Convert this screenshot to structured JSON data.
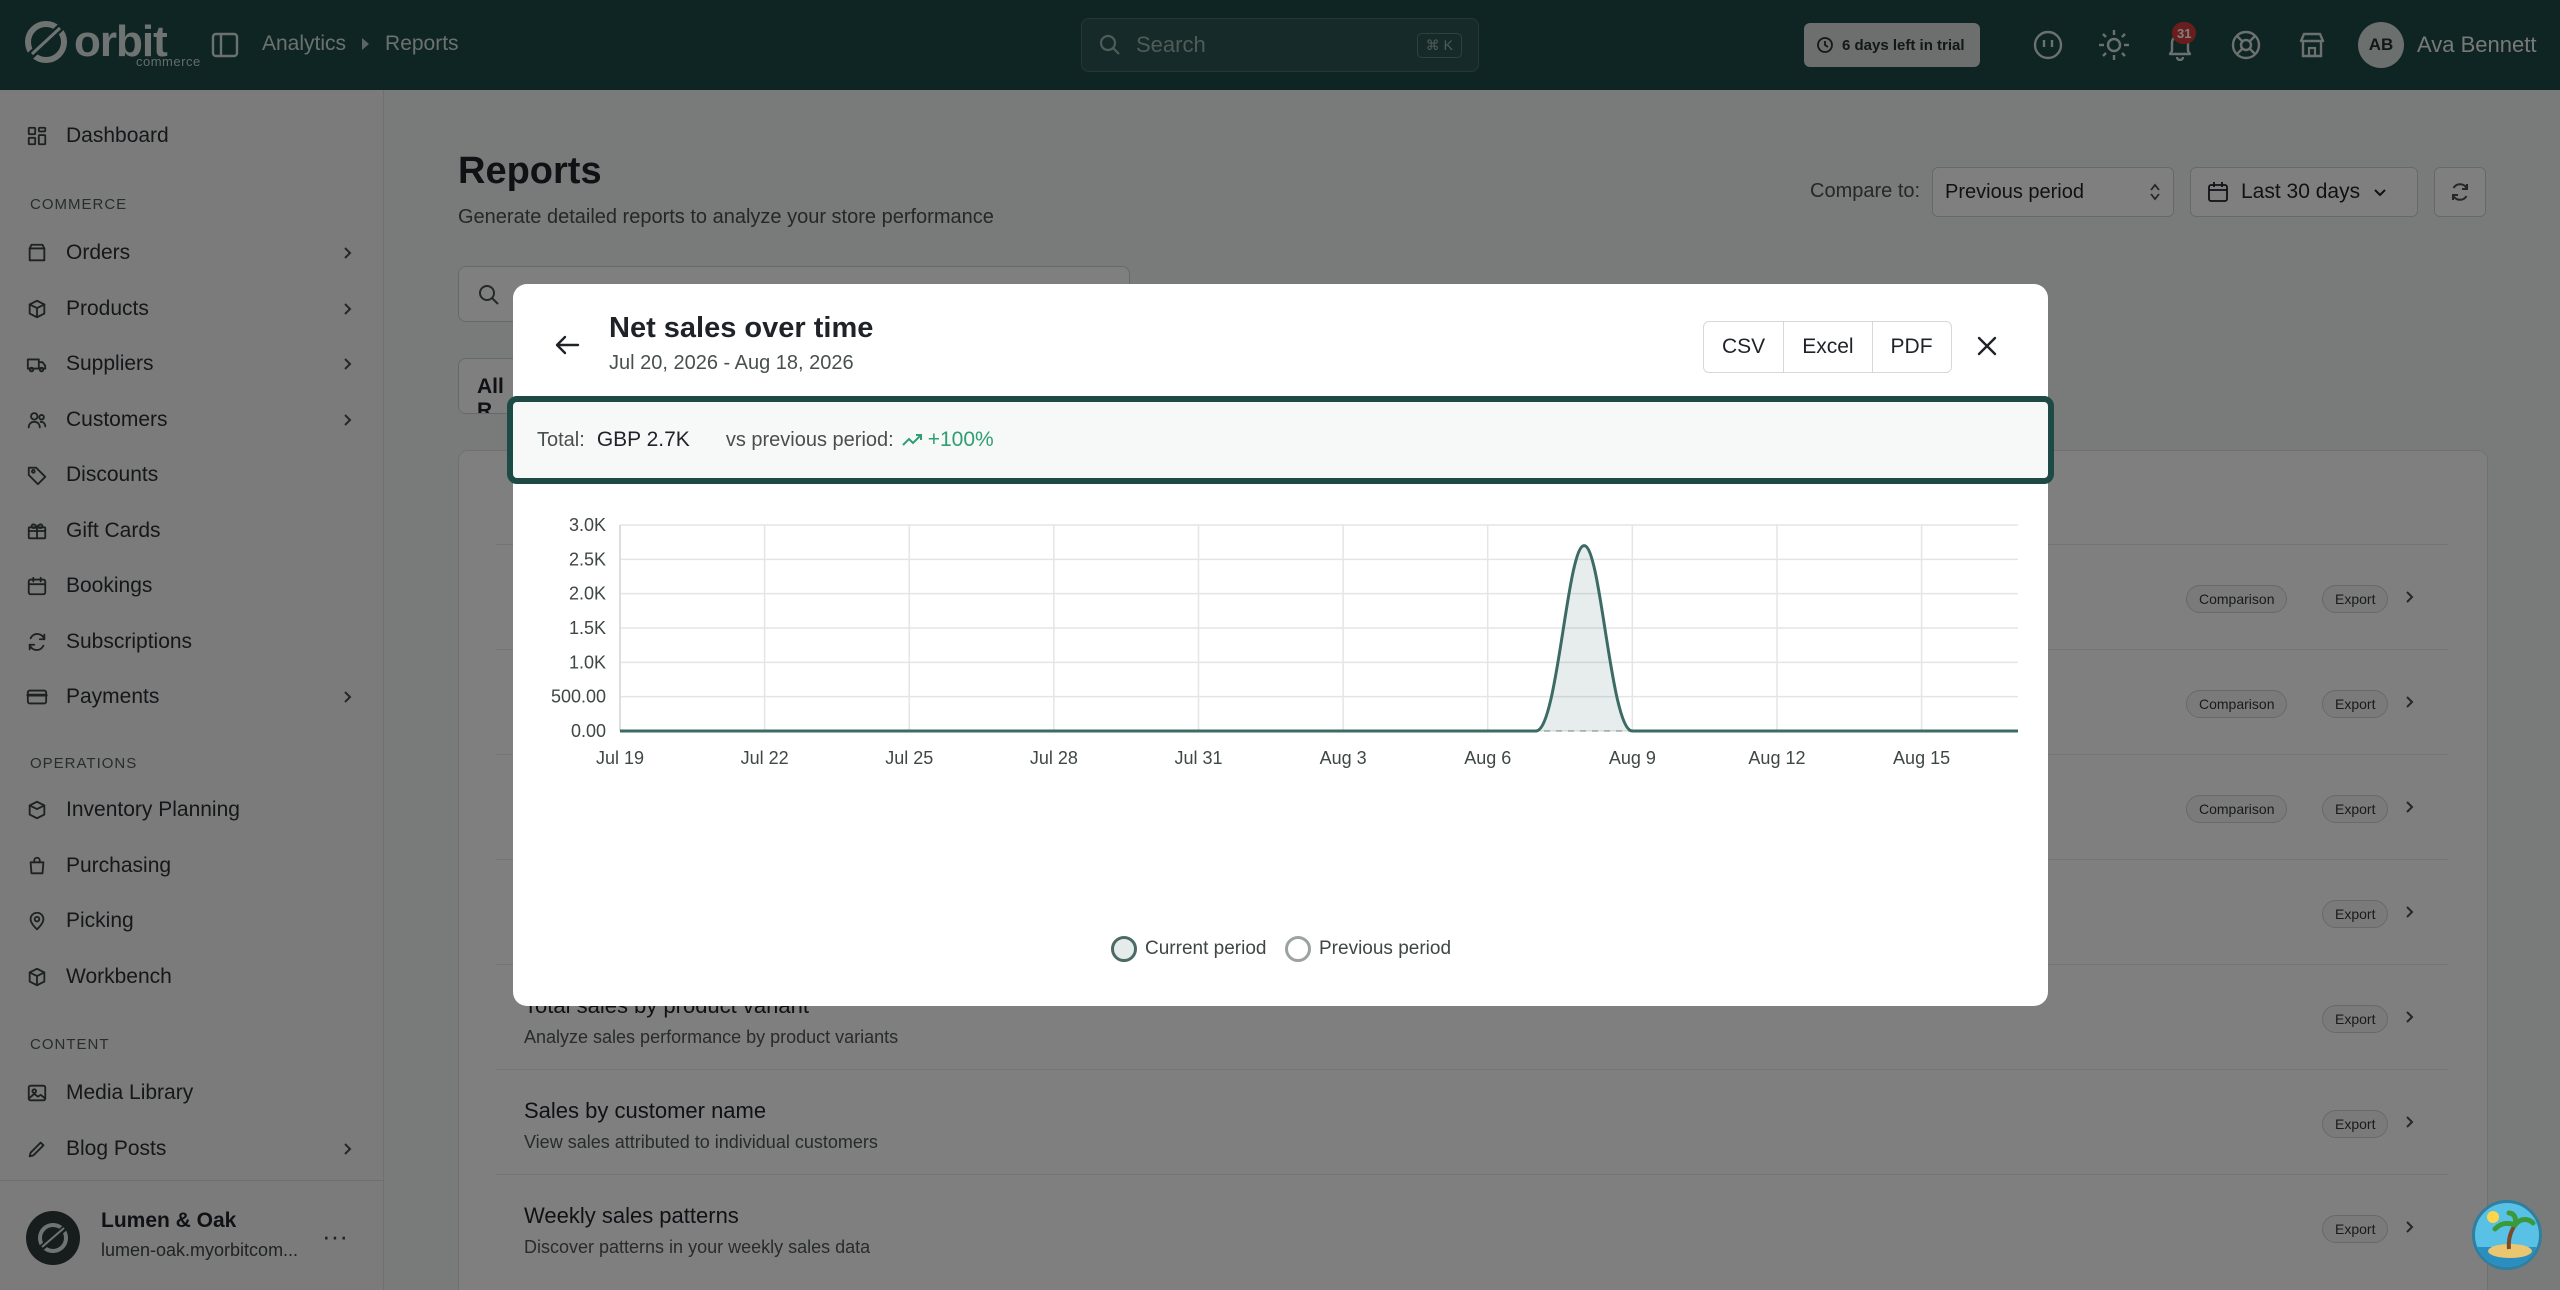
{
  "topbar": {
    "logo_text": "orbit",
    "logo_sub": "commerce",
    "breadcrumbs": [
      "Analytics",
      "Reports"
    ],
    "search_placeholder": "Search",
    "search_shortcut": "⌘ K",
    "trial_text": "6 days left in trial",
    "notification_count": "31",
    "user_initials": "AB",
    "user_name": "Ava Bennett"
  },
  "sidebar": {
    "top_item": "Dashboard",
    "sections": [
      {
        "title": "COMMERCE",
        "items": [
          "Orders",
          "Products",
          "Suppliers",
          "Customers",
          "Discounts",
          "Gift Cards",
          "Bookings",
          "Subscriptions",
          "Payments"
        ]
      },
      {
        "title": "OPERATIONS",
        "items": [
          "Inventory Planning",
          "Purchasing",
          "Picking",
          "Workbench"
        ]
      },
      {
        "title": "CONTENT",
        "items": [
          "Media Library",
          "Blog Posts"
        ]
      }
    ],
    "store": {
      "name": "Lumen & Oak",
      "url": "lumen-oak.myorbitcom..."
    }
  },
  "page": {
    "title": "Reports",
    "subtitle": "Generate detailed reports to analyze your store performance",
    "compare_label": "Compare to:",
    "compare_value": "Previous period",
    "date_range": "Last 30 days",
    "filter_chip": "All R",
    "rows": [
      {
        "title": "",
        "desc": "",
        "tags": [
          "Comparison",
          "Export"
        ]
      },
      {
        "title": "",
        "desc": "",
        "tags": [
          "Comparison",
          "Export"
        ]
      },
      {
        "title": "",
        "desc": "",
        "tags": [
          "Comparison",
          "Export"
        ]
      },
      {
        "title": "",
        "desc": "",
        "tags": [
          "Export"
        ]
      },
      {
        "title": "Total sales by product variant",
        "desc": "Analyze sales performance by product variants",
        "tags": [
          "Export"
        ]
      },
      {
        "title": "Sales by customer name",
        "desc": "View sales attributed to individual customers",
        "tags": [
          "Export"
        ]
      },
      {
        "title": "Weekly sales patterns",
        "desc": "Discover patterns in your weekly sales data",
        "tags": [
          "Export"
        ]
      }
    ]
  },
  "modal": {
    "title": "Net sales over time",
    "date_range": "Jul 20, 2026 - Aug 18, 2026",
    "export_buttons": [
      "CSV",
      "Excel",
      "PDF"
    ],
    "total_label": "Total:",
    "total_value": "GBP 2.7K",
    "vs_label": "vs previous period:",
    "delta": "+100%",
    "legend": [
      "Current period",
      "Previous period"
    ]
  },
  "colors": {
    "brand": "#1e4a46",
    "positive": "#2f9e72",
    "line": "#3c6a64",
    "badge": "#d43b3b"
  },
  "chart_data": {
    "type": "area",
    "x_ticks": [
      "Jul 19",
      "Jul 22",
      "Jul 25",
      "Jul 28",
      "Jul 31",
      "Aug 3",
      "Aug 6",
      "Aug 9",
      "Aug 12",
      "Aug 15"
    ],
    "y_ticks": [
      "0.00",
      "500.00",
      "1.0K",
      "1.5K",
      "2.0K",
      "2.5K",
      "3.0K"
    ],
    "ylim": [
      0,
      3000
    ],
    "x_days": [
      0,
      29
    ],
    "grid": true,
    "legend_position": "bottom",
    "series": [
      {
        "name": "Current period",
        "points": [
          [
            0,
            0
          ],
          [
            19,
            0
          ],
          [
            20,
            2700
          ],
          [
            21,
            0
          ],
          [
            29,
            0
          ]
        ]
      },
      {
        "name": "Previous period",
        "points": [
          [
            0,
            0
          ],
          [
            29,
            0
          ]
        ]
      }
    ]
  }
}
